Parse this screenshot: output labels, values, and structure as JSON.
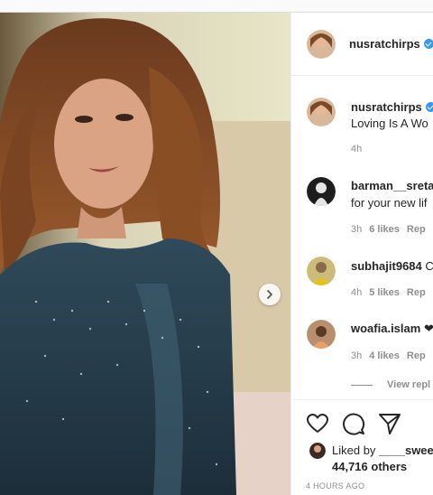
{
  "post": {
    "author": "nusratchirps",
    "caption": "Loving Is A Wo",
    "caption_time": "4h"
  },
  "comments": [
    {
      "user": "barman__sreta",
      "text": "for your new lif",
      "time": "3h",
      "likes": "6 likes",
      "reply": "Rep"
    },
    {
      "user": "subhajit9684",
      "text": "C",
      "time": "4h",
      "likes": "5 likes",
      "reply": "Rep"
    },
    {
      "user": "woafia.islam",
      "text": "❤",
      "time": "3h",
      "likes": "4 likes",
      "reply": "Rep"
    }
  ],
  "view_replies": "View repl",
  "engagement": {
    "liked_by_prefix": "Liked by",
    "liked_by_user": "____sweet",
    "others": "44,716 others",
    "timestamp": "4 HOURS AGO"
  },
  "icons": {
    "like": "heart-icon",
    "comment": "comment-icon",
    "share": "share-icon",
    "next": "chevron-right-icon"
  }
}
